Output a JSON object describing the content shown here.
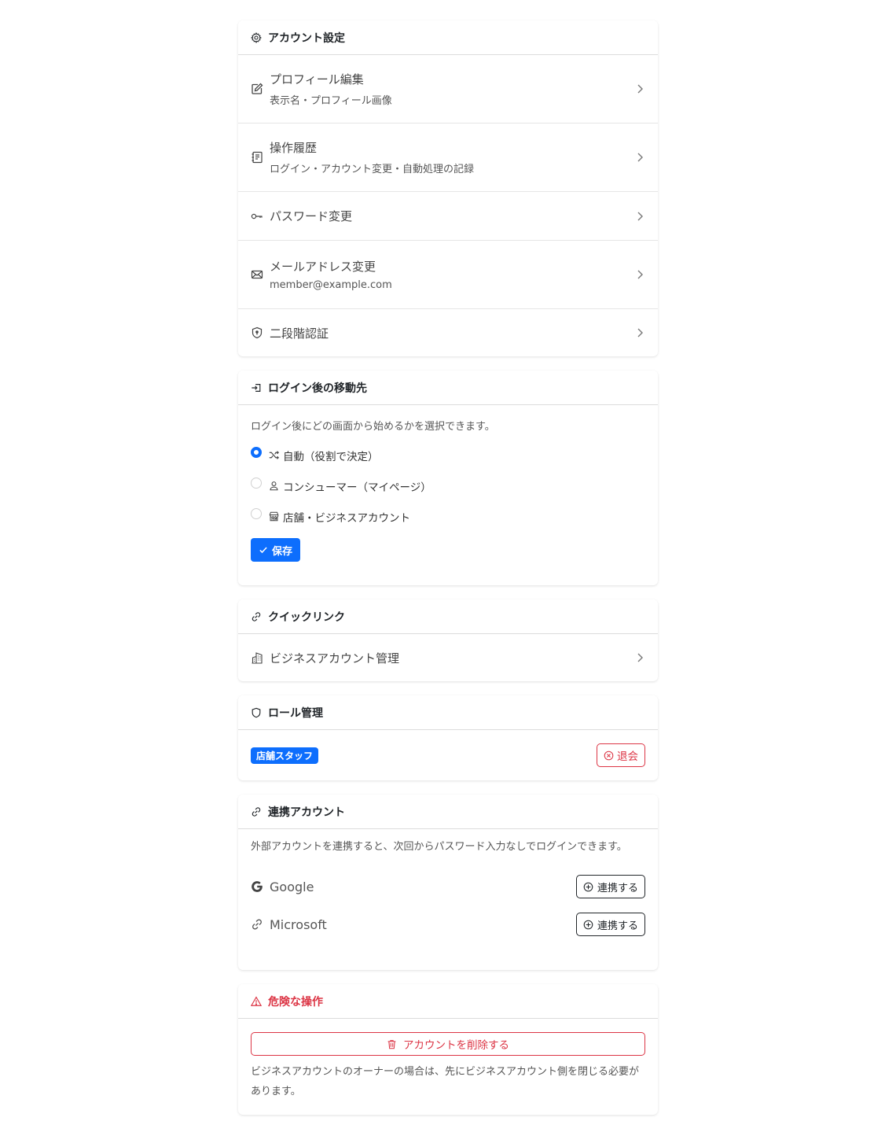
{
  "account_settings": {
    "title": "アカウント設定",
    "icon": "gear-icon",
    "items": [
      {
        "label": "プロフィール編集",
        "sub": "表示名・プロフィール画像",
        "icon": "pencil-square-icon"
      },
      {
        "label": "操作履歴",
        "sub": "ログイン・アカウント変更・自動処理の記録",
        "icon": "journal-text-icon"
      },
      {
        "label": "パスワード変更",
        "sub": "",
        "icon": "key-icon"
      },
      {
        "label": "メールアドレス変更",
        "sub": "member@example.com",
        "icon": "envelope-icon"
      },
      {
        "label": "二段階認証",
        "sub": "",
        "icon": "shield-lock-icon"
      }
    ]
  },
  "landing": {
    "title": "ログイン後の移動先",
    "icon": "box-arrow-in-right-icon",
    "description": "ログイン後にどの画面から始めるかを選択できます。",
    "options": [
      {
        "label": "自動（役割で決定）",
        "icon": "shuffle-icon",
        "checked": true
      },
      {
        "label": "コンシューマー（マイページ）",
        "icon": "person-icon",
        "checked": false
      },
      {
        "label": "店舗・ビジネスアカウント",
        "icon": "shop-icon",
        "checked": false
      }
    ],
    "save_label": "保存"
  },
  "quick_links": {
    "title": "クイックリンク",
    "icon": "link-icon",
    "items": [
      {
        "label": "ビジネスアカウント管理",
        "icon": "buildings-icon"
      }
    ]
  },
  "roles": {
    "title": "ロール管理",
    "icon": "shield-icon",
    "badge": "店舗スタッフ",
    "leave_label": "退会"
  },
  "linked_accounts": {
    "title": "連携アカウント",
    "icon": "link-icon",
    "description": "外部アカウントを連携すると、次回からパスワード入力なしでログインできます。",
    "providers": [
      {
        "name": "Google",
        "icon": "google-icon",
        "action": "連携する"
      },
      {
        "name": "Microsoft",
        "icon": "link-icon",
        "action": "連携する"
      }
    ]
  },
  "danger_zone": {
    "title": "危険な操作",
    "icon": "exclamation-triangle-icon",
    "delete_label": "アカウントを削除する",
    "note": "ビジネスアカウントのオーナーの場合は、先にビジネスアカウント側を閉じる必要があります。"
  },
  "colors": {
    "primary": "#0d6efd",
    "danger": "#dc3545",
    "text": "#212529",
    "muted": "#555555"
  }
}
